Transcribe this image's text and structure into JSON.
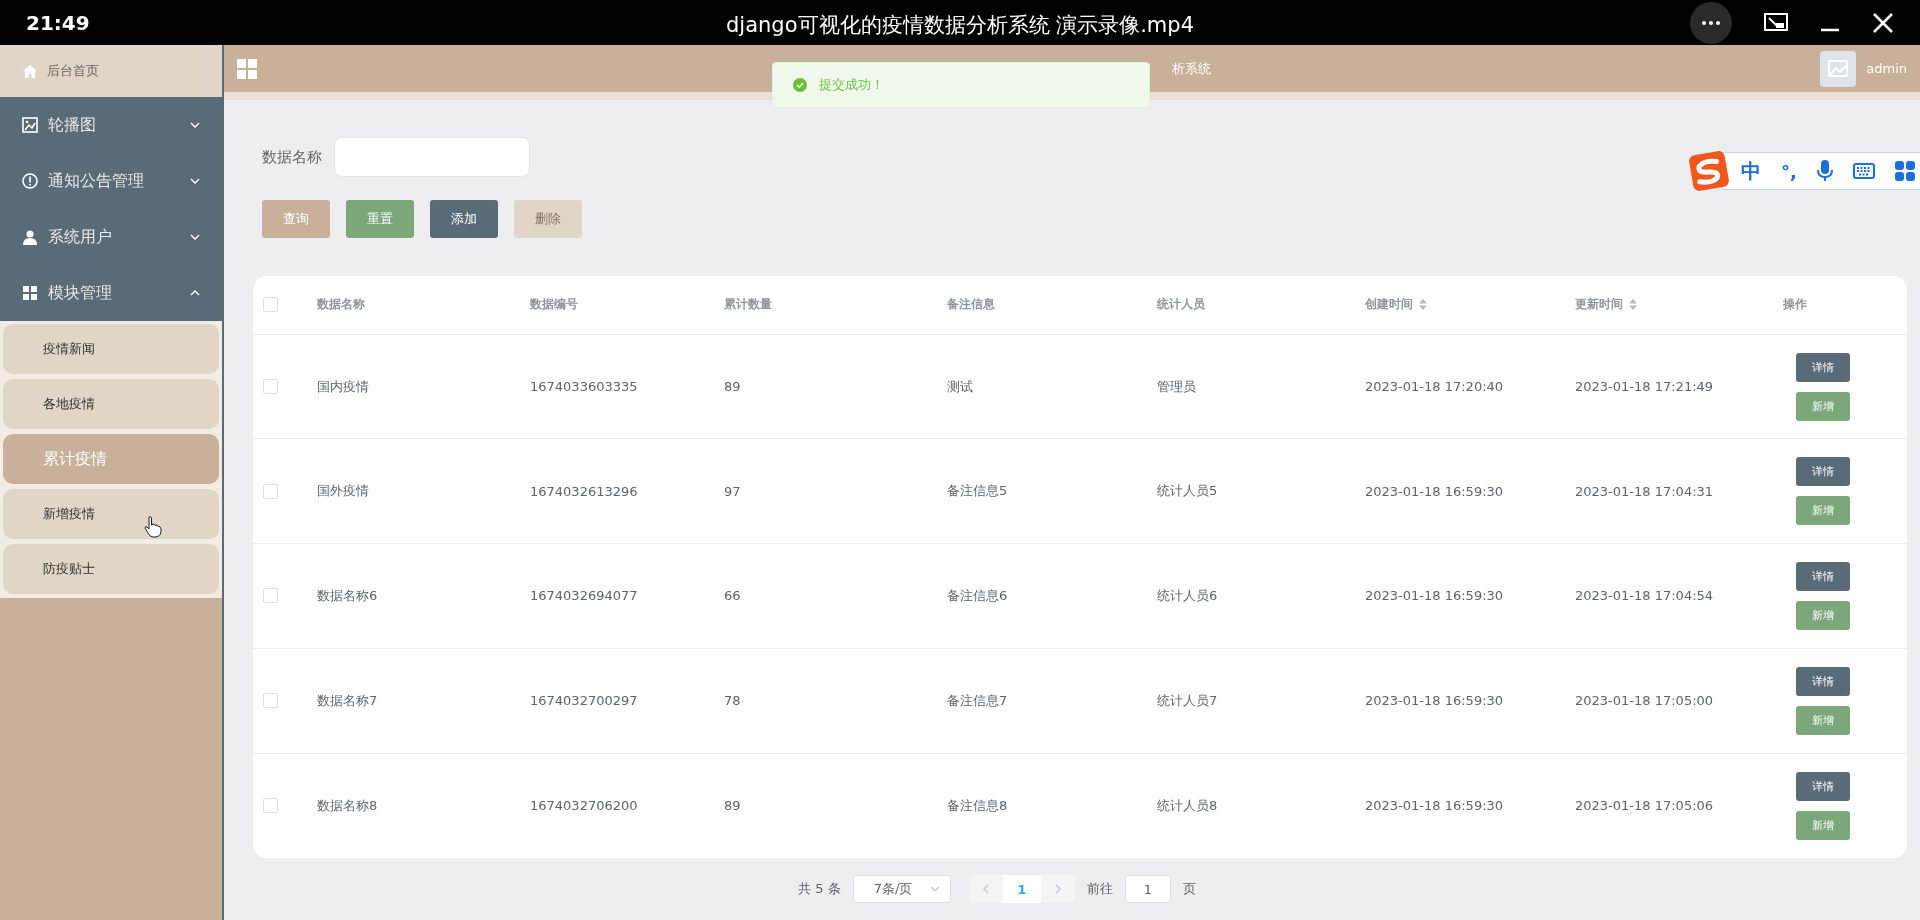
{
  "player": {
    "time": "21:49",
    "title": "django可视化的疫情数据分析系统 演示录像.mp4"
  },
  "sidebar": {
    "home": "后台首页",
    "menus": [
      {
        "label": "轮播图",
        "expanded": false
      },
      {
        "label": "通知公告管理",
        "expanded": false
      },
      {
        "label": "系统用户",
        "expanded": false
      },
      {
        "label": "模块管理",
        "expanded": true,
        "children": [
          {
            "label": "疫情新闻",
            "selected": false
          },
          {
            "label": "各地疫情",
            "selected": false
          },
          {
            "label": "累计疫情",
            "selected": true
          },
          {
            "label": "新增疫情",
            "selected": false
          },
          {
            "label": "防疫贴士",
            "selected": false
          }
        ]
      }
    ]
  },
  "header": {
    "title_fragment": "析系统",
    "user": "admin"
  },
  "toast": {
    "message": "提交成功！"
  },
  "search": {
    "label": "数据名称"
  },
  "buttons": [
    {
      "label": "查询",
      "kind": "query",
      "disabled": false
    },
    {
      "label": "重置",
      "kind": "reset",
      "disabled": false
    },
    {
      "label": "添加",
      "kind": "add",
      "disabled": false
    },
    {
      "label": "删除",
      "kind": "delete",
      "disabled": true
    }
  ],
  "table": {
    "all_checked": false,
    "columns": [
      {
        "label": "数据名称",
        "sortable": false
      },
      {
        "label": "数据编号",
        "sortable": false
      },
      {
        "label": "累计数量",
        "sortable": false
      },
      {
        "label": "备注信息",
        "sortable": false
      },
      {
        "label": "统计人员",
        "sortable": false
      },
      {
        "label": "创建时间",
        "sortable": true
      },
      {
        "label": "更新时间",
        "sortable": true
      },
      {
        "label": "操作",
        "sortable": false
      }
    ],
    "rows": [
      {
        "checked": false,
        "cells": [
          "国内疫情",
          "1674033603335",
          "89",
          "测试",
          "管理员",
          "2023-01-18 17:20:40",
          "2023-01-18 17:21:49"
        ],
        "actions": [
          "详情",
          "新增"
        ]
      },
      {
        "checked": false,
        "cells": [
          "国外疫情",
          "1674032613296",
          "97",
          "备注信息5",
          "统计人员5",
          "2023-01-18 16:59:30",
          "2023-01-18 17:04:31"
        ],
        "actions": [
          "详情",
          "新增"
        ]
      },
      {
        "checked": false,
        "cells": [
          "数据名称6",
          "1674032694077",
          "66",
          "备注信息6",
          "统计人员6",
          "2023-01-18 16:59:30",
          "2023-01-18 17:04:54"
        ],
        "actions": [
          "详情",
          "新增"
        ]
      },
      {
        "checked": false,
        "cells": [
          "数据名称7",
          "1674032700297",
          "78",
          "备注信息7",
          "统计人员7",
          "2023-01-18 16:59:30",
          "2023-01-18 17:05:00"
        ],
        "actions": [
          "详情",
          "新增"
        ]
      },
      {
        "checked": false,
        "cells": [
          "数据名称8",
          "1674032706200",
          "89",
          "备注信息8",
          "统计人员8",
          "2023-01-18 16:59:30",
          "2023-01-18 17:05:06"
        ],
        "actions": [
          "详情",
          "新增"
        ]
      }
    ]
  },
  "pagination": {
    "total": "共 5 条",
    "page_size": "7条/页",
    "pages": [
      {
        "label": "1",
        "selected": true
      }
    ],
    "goto_label": "前往",
    "goto_value": "1",
    "goto_suffix": "页"
  },
  "ime": {
    "mode": "中",
    "punct": "°,"
  }
}
